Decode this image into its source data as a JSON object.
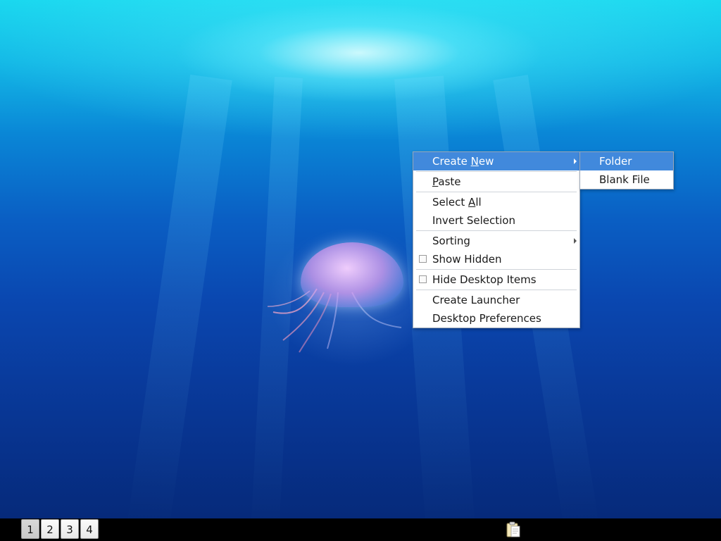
{
  "context_menu": {
    "items": [
      {
        "label_pre": "Create ",
        "label_accel": "N",
        "label_post": "ew",
        "highlighted": true,
        "has_submenu": true
      },
      {
        "label_pre": "",
        "label_accel": "P",
        "label_post": "aste"
      },
      {
        "label_pre": "Select ",
        "label_accel": "A",
        "label_post": "ll"
      },
      {
        "label": "Invert Selection"
      },
      {
        "label": "Sorting",
        "has_submenu": true
      },
      {
        "label": "Show Hidden",
        "checkbox": true,
        "checked": false
      },
      {
        "label": "Hide Desktop Items",
        "checkbox": true,
        "checked": false
      },
      {
        "label": "Create Launcher"
      },
      {
        "label": "Desktop Preferences"
      }
    ]
  },
  "submenu": {
    "items": [
      {
        "label": "Folder",
        "highlighted": true
      },
      {
        "label": "Blank File"
      }
    ]
  },
  "taskbar": {
    "workspaces": [
      "1",
      "2",
      "3",
      "4"
    ],
    "active_workspace": "1",
    "tray_icon": "clipboard-icon"
  },
  "colors": {
    "menu_highlight": "#4189dc",
    "taskbar": "#000000"
  }
}
